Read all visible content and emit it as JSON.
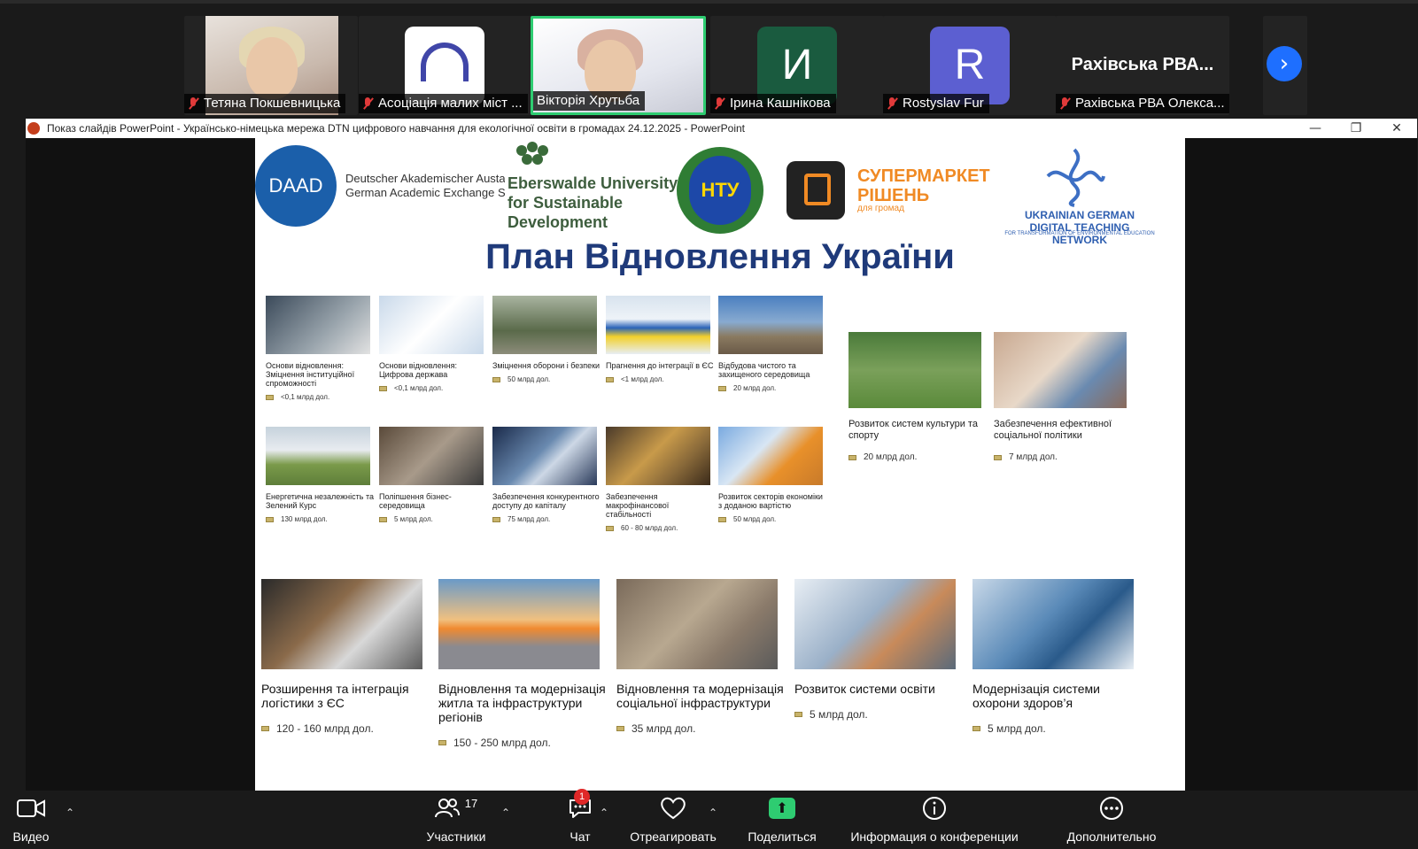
{
  "participants": [
    {
      "name": "Тетяна Покшевницька"
    },
    {
      "name": "Асоціація малих міст ..."
    },
    {
      "name": "Вікторія Хрутьба"
    },
    {
      "name": "Ірина Кашнікова",
      "initial": "И"
    },
    {
      "name": "Rostyslav Fur",
      "initial": "R"
    },
    {
      "name": "Рахівська РВА Олекса...",
      "display": "Рахівська РВА..."
    }
  ],
  "colors": {
    "active_speaker": "#2ecc71",
    "avatar_green": "#1a5b3f",
    "avatar_purple": "#5c5fd1",
    "slide_title": "#1f3a7a",
    "zoom_blue": "#1e6fff"
  },
  "icons": {
    "next": "chevron-right-icon"
  },
  "window": {
    "title": "Показ слайдів PowerPoint  -  Українсько-німецька мережа DTN цифрового навчання для екологічної освіти в громадах 24.12.2025 - PowerPoint",
    "minimize": "—",
    "restore": "❐",
    "close": "✕"
  },
  "slide": {
    "logos": {
      "daad": "DAAD",
      "daad_line1": "Deutscher Akademischer Austausch",
      "daad_line2": "German Academic Exchange Service",
      "ebers_line1": "Eberswalde University",
      "ebers_line2": "for Sustainable",
      "ebers_line3": "Development",
      "ntu": "НТУ",
      "super_line1": "СУПЕРМАРКЕТ",
      "super_line2": "РІШЕНЬ",
      "super_sub": "для громад",
      "ugdtn_line1": "UKRAINIAN GERMAN",
      "ugdtn_line2": "DIGITAL TEACHING NETWORK",
      "ugdtn_sub": "FOR TRANSFORMATION OF ENVIRONMENTAL EDUCATION"
    },
    "title": "План Відновлення України",
    "cards_small": [
      {
        "title": "Основи відновлення: Зміцнення інституційної спроможності",
        "value": "<0,1 млрд дол."
      },
      {
        "title": "Основи відновлення: Цифрова держава",
        "value": "<0,1 млрд дол."
      },
      {
        "title": "Зміцнення оборони і безпеки",
        "value": "50 млрд дол."
      },
      {
        "title": "Прагнення до інтеграції в ЄС",
        "value": "<1 млрд дол."
      },
      {
        "title": "Відбудова чистого та захищеного середовища",
        "value": "20 млрд дол."
      },
      {
        "title": "Енергетична незалежність та Зелений Курс",
        "value": "130 млрд дол."
      },
      {
        "title": "Поліпшення бізнес-середовища",
        "value": "5 млрд дол."
      },
      {
        "title": "Забезпечення конкурентного доступу до капіталу",
        "value": "75 млрд дол."
      },
      {
        "title": "Забезпечення макрофінансової стабільності",
        "value": "60 - 80 млрд дол."
      },
      {
        "title": "Розвиток секторів економіки з доданою вартістю",
        "value": "50 млрд дол."
      }
    ],
    "cards_medium": [
      {
        "title": "Розвиток систем культури та спорту",
        "value": "20 млрд дол."
      },
      {
        "title": "Забезпечення ефективної соціальної політики",
        "value": "7 млрд дол."
      }
    ],
    "cards_large": [
      {
        "title": "Розширення та інтеграція логістики з ЄС",
        "value": "120 - 160 млрд дол."
      },
      {
        "title": "Відновлення та модернізація житла та інфраструктури регіонів",
        "value": "150 - 250 млрд дол."
      },
      {
        "title": "Відновлення та модернізація соціальної інфраструктури",
        "value": "35 млрд дол."
      },
      {
        "title": "Розвиток системи освіти",
        "value": "5 млрд дол."
      },
      {
        "title": "Модернізація системи охорони здоров’я",
        "value": "5 млрд дол."
      }
    ]
  },
  "toolbar": {
    "video": "Видео",
    "participants": "Участники",
    "participants_count": "17",
    "chat": "Чат",
    "chat_badge": "1",
    "react": "Отреагировать",
    "share": "Поделиться",
    "info": "Информация о конференции",
    "more": "Дополнительно"
  }
}
